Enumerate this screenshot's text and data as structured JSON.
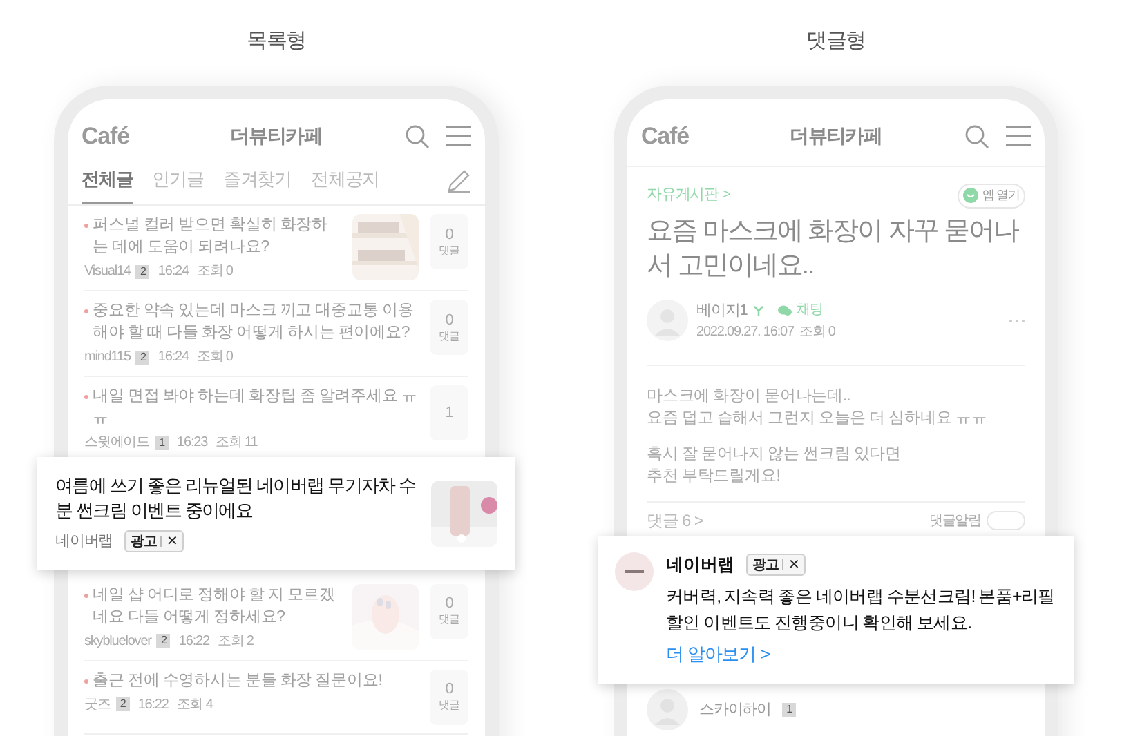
{
  "list_view": {
    "label": "목록형",
    "header": {
      "logo": "Café",
      "title": "더뷰티카페"
    },
    "tabs": [
      {
        "label": "전체글",
        "selected": true
      },
      {
        "label": "인기글",
        "selected": false
      },
      {
        "label": "즐겨찾기",
        "selected": false
      },
      {
        "label": "전체공지",
        "selected": false
      }
    ],
    "items": [
      {
        "kind": "post",
        "title": "퍼스널 컬러 받으면 확실히 화장하는 데에 도움이 되려나요?",
        "author": "Visual14",
        "level": "2",
        "time": "16:24",
        "views": "조회 0",
        "thumbnail": true,
        "comments": "0",
        "comments_label": "댓글"
      },
      {
        "kind": "post",
        "title": "중요한 약속 있는데 마스크 끼고 대중교통 이용해야 할 때 다들 화장 어떻게 하시는 편이에요?",
        "author": "mind115",
        "level": "2",
        "time": "16:24",
        "views": "조회 0",
        "thumbnail": false,
        "comments": "0",
        "comments_label": "댓글"
      },
      {
        "kind": "post",
        "title": "내일 면접 봐야 하는데 화장팁 좀 알려주세요 ㅠㅠ",
        "author": "스윗에이드",
        "level": "1",
        "time": "16:23",
        "views": "조회 11",
        "thumbnail": false,
        "comments": "1"
      },
      {
        "kind": "ad",
        "title": "여름에 쓰기 좋은 리뉴얼된 네이버랩 무기자차 수분 썬크림 이벤트 중이에요",
        "advertiser": "네이버랩",
        "ad_label": "광고",
        "close": "✕"
      },
      {
        "kind": "post",
        "title": "네일 샵 어디로 정해야 할 지 모르겠네요 다들 어떻게 정하세요?",
        "author": "skybluelover",
        "level": "2",
        "time": "16:22",
        "views": "조회 2",
        "thumbnail": true,
        "comments": "0",
        "comments_label": "댓글"
      },
      {
        "kind": "post",
        "title": "출근 전에 수영하시는 분들 화장 질문이요!",
        "author": "굿즈",
        "level": "2",
        "time": "16:22",
        "views": "조회 4",
        "thumbnail": false,
        "comments": "0",
        "comments_label": "댓글"
      }
    ]
  },
  "comment_view": {
    "label": "댓글형",
    "header": {
      "logo": "Café",
      "title": "더뷰티카페"
    },
    "board": "자유게시판 >",
    "open_app": "앱 열기",
    "title": "요즘 마스크에 화장이 자꾸 묻어나서 고민이네요..",
    "author": "베이지1",
    "chat": "채팅",
    "date": "2022.09.27. 16:07",
    "views": "조회 0",
    "body": [
      [
        "마스크에 화장이 묻어나는데..",
        "요즘 덥고 습해서 그런지 오늘은 더 심하네요 ㅠㅠ"
      ],
      [
        "혹시 잘 묻어나지 않는 썬크림 있다면",
        "추천 부탁드릴게요!"
      ]
    ],
    "comment_count": "댓글 6 >",
    "notify": "댓글알림",
    "notify_on": false,
    "ad": {
      "advertiser": "네이버랩",
      "ad_label": "광고",
      "close": "✕",
      "text": "커버력, 지속력 좋은 네이버랩 수분선크림! 본품+리필 할인 이벤트도 진행중이니 확인해 보세요.",
      "link": "더 알아보기 >"
    },
    "commenter": {
      "name": "스카이하이",
      "level": "1"
    }
  }
}
